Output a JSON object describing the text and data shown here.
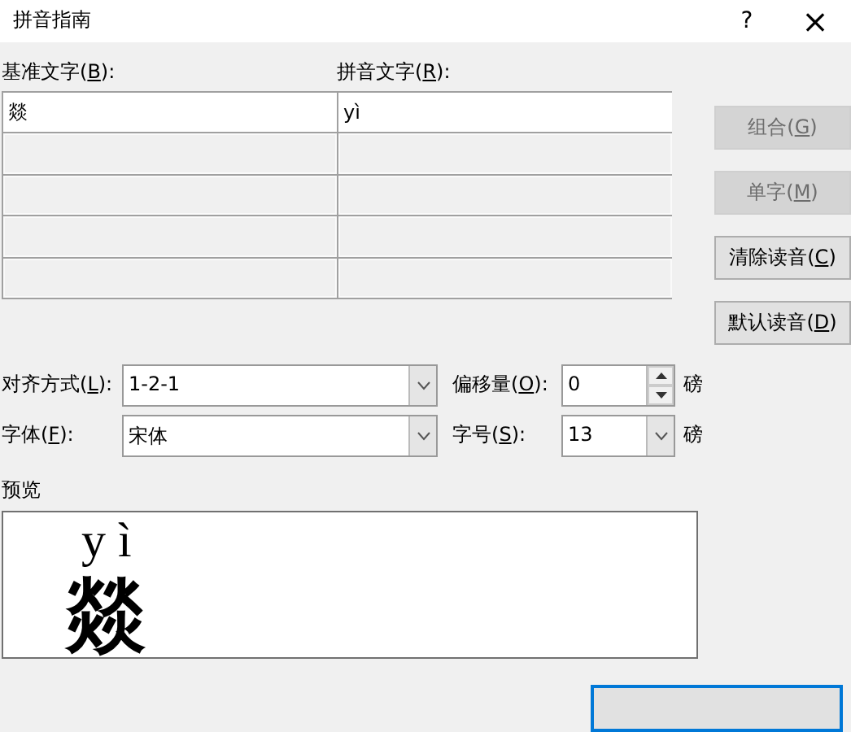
{
  "window": {
    "title": "拼音指南",
    "help": "?",
    "close": "×"
  },
  "columns": [
    {
      "before": "基准文字(",
      "mnemonic": "B",
      "after": "):"
    },
    {
      "before": "拼音文字(",
      "mnemonic": "R",
      "after": "):"
    }
  ],
  "rows": [
    {
      "base": "燚",
      "ruby": "yì",
      "disabled": false
    },
    {
      "disabled": true
    },
    {
      "disabled": true
    },
    {
      "disabled": true
    },
    {
      "disabled": true
    }
  ],
  "buttons": [
    {
      "before": "组合(",
      "mnemonic": "G",
      "after": ")",
      "disabled": true
    },
    {
      "before": "单字(",
      "mnemonic": "M",
      "after": ")",
      "disabled": true
    },
    {
      "before": "清除读音(",
      "mnemonic": "C",
      "after": ")",
      "disabled": false
    },
    {
      "before": "默认读音(",
      "mnemonic": "D",
      "after": ")",
      "disabled": false
    }
  ],
  "settings": [
    {
      "label": {
        "before": "对齐方式(",
        "mnemonic": "L",
        "after": "):"
      },
      "value": "1-2-1",
      "side_label": {
        "before": "偏移量(",
        "mnemonic": "O",
        "after": "):"
      },
      "side_field": {
        "kind": "spinner",
        "value": "0"
      },
      "unit": "磅"
    },
    {
      "label": {
        "before": "字体(",
        "mnemonic": "F",
        "after": "):"
      },
      "value": "宋体",
      "side_label": {
        "before": "字号(",
        "mnemonic": "S",
        "after": "):"
      },
      "side_field": {
        "kind": "combo",
        "value": "13"
      },
      "unit": "磅"
    }
  ],
  "preview": {
    "label": "预览",
    "ruby": "y ì",
    "base": "燚"
  },
  "footer": {
    "default_button": true
  }
}
